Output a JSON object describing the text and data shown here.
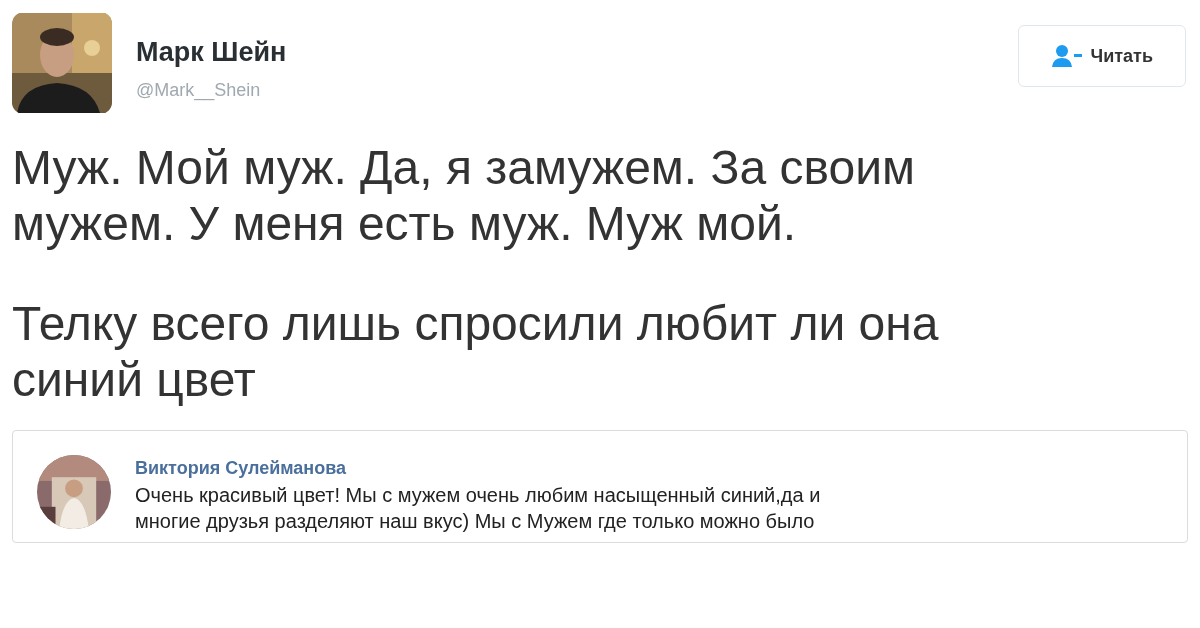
{
  "author": {
    "name": "Марк Шейн",
    "handle": "@Mark__Shein"
  },
  "follow_button": {
    "label": "Читать"
  },
  "tweet": {
    "paragraphs": [
      [
        "Муж. Мой муж. Да, я замужем. За своим",
        "мужем. У меня есть муж. Муж мой."
      ],
      [
        "Телку всего лишь спросили любит ли она",
        "синий цвет"
      ]
    ]
  },
  "quoted": {
    "author": "Виктория Сулейманова",
    "lines": [
      "Очень красивый цвет! Мы с мужем очень любим насыщенный синий,да и",
      "многие друзья разделяют наш вкус) Мы с Мужем где только можно было"
    ]
  }
}
